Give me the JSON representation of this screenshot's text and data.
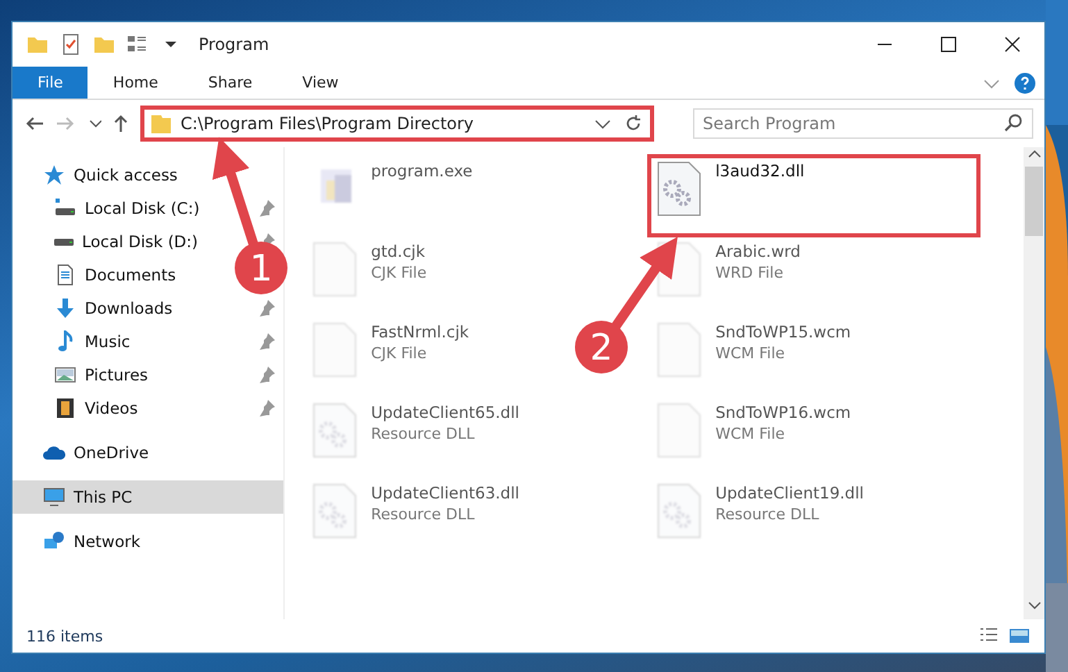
{
  "window": {
    "title": "Program"
  },
  "ribbon": {
    "tabs": [
      {
        "label": "File",
        "selected": true
      },
      {
        "label": "Home",
        "selected": false
      },
      {
        "label": "Share",
        "selected": false
      },
      {
        "label": "View",
        "selected": false
      }
    ]
  },
  "address": {
    "path": "C:\\Program Files\\Program Directory",
    "highlighted": true
  },
  "search": {
    "placeholder": "Search Program"
  },
  "sidebar": {
    "items": [
      {
        "label": "Quick access",
        "kind": "quick",
        "selected": false,
        "children": [
          {
            "label": "Local Disk (C:)",
            "kind": "drive-c",
            "pinned": true,
            "selected": false
          },
          {
            "label": "Local Disk (D:)",
            "kind": "drive",
            "pinned": true,
            "selected": false
          },
          {
            "label": "Documents",
            "kind": "documents",
            "selected": false
          },
          {
            "label": "Downloads",
            "kind": "downloads",
            "pinned": true,
            "selected": false
          },
          {
            "label": "Music",
            "kind": "music",
            "pinned": true,
            "selected": false
          },
          {
            "label": "Pictures",
            "kind": "pictures",
            "pinned": true,
            "selected": false
          },
          {
            "label": "Videos",
            "kind": "videos",
            "pinned": true,
            "selected": false
          }
        ]
      },
      {
        "label": "OneDrive",
        "kind": "onedrive",
        "selected": false
      },
      {
        "label": "This PC",
        "kind": "pc",
        "selected": true
      },
      {
        "label": "Network",
        "kind": "network",
        "selected": false
      }
    ]
  },
  "files": [
    {
      "name": "program.exe",
      "kind": "exe",
      "blurred": true,
      "highlighted": false
    },
    {
      "name": "l3aud32.dll",
      "kind": "dll",
      "blurred": false,
      "highlighted": true
    },
    {
      "name": "gtd.cjk",
      "type": "CJK File",
      "kind": "blank",
      "blurred": true,
      "highlighted": false
    },
    {
      "name": "Arabic.wrd",
      "type": "WRD File",
      "kind": "blank",
      "blurred": true,
      "highlighted": false
    },
    {
      "name": "FastNrml.cjk",
      "type": "CJK File",
      "kind": "blank",
      "blurred": true,
      "highlighted": false
    },
    {
      "name": "SndToWP15.wcm",
      "type": "WCM File",
      "kind": "blank",
      "blurred": true,
      "highlighted": false
    },
    {
      "name": "UpdateClient65.dll",
      "type": "Resource DLL",
      "kind": "dll",
      "blurred": true,
      "highlighted": false
    },
    {
      "name": "SndToWP16.wcm",
      "type": "WCM File",
      "kind": "blank",
      "blurred": true,
      "highlighted": false
    },
    {
      "name": "UpdateClient63.dll",
      "type": "Resource DLL",
      "kind": "dll",
      "blurred": true,
      "highlighted": false
    },
    {
      "name": "UpdateClient19.dll",
      "type": "Resource DLL",
      "kind": "dll",
      "blurred": true,
      "highlighted": false
    }
  ],
  "status_bar": {
    "count": "116 items"
  },
  "annotations": [
    {
      "label": "1"
    },
    {
      "label": "2"
    }
  ]
}
